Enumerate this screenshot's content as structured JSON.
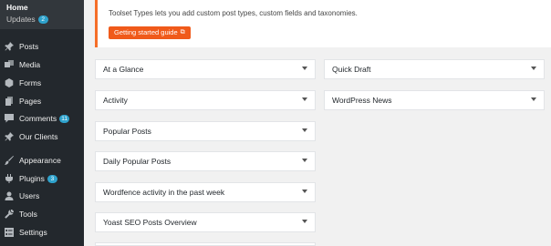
{
  "sidebar": {
    "home": "Home",
    "updates": {
      "label": "Updates",
      "count": "2"
    },
    "items": [
      {
        "label": "Posts",
        "icon": "pin-icon"
      },
      {
        "label": "Media",
        "icon": "media-icon"
      },
      {
        "label": "Forms",
        "icon": "forms-icon"
      },
      {
        "label": "Pages",
        "icon": "pages-icon"
      },
      {
        "label": "Comments",
        "icon": "comment-icon",
        "badge": "11"
      },
      {
        "label": "Our Clients",
        "icon": "pin-icon"
      },
      {
        "label": "Appearance",
        "icon": "brush-icon"
      },
      {
        "label": "Plugins",
        "icon": "plugin-icon",
        "badge": "3"
      },
      {
        "label": "Users",
        "icon": "user-icon"
      },
      {
        "label": "Tools",
        "icon": "wrench-icon"
      },
      {
        "label": "Settings",
        "icon": "settings-icon"
      }
    ]
  },
  "notice": {
    "message": "Toolset Types lets you add custom post types, custom fields and taxonomies.",
    "button": "Getting started guide"
  },
  "widgets": {
    "left": [
      "At a Glance",
      "Activity",
      "Popular Posts",
      "Daily Popular Posts",
      "Wordfence activity in the past week",
      "Yoast SEO Posts Overview"
    ],
    "right": [
      "Quick Draft",
      "WordPress News"
    ]
  },
  "colors": {
    "sidebar": "#23282d",
    "accent": "#f05a1a",
    "badge": "#2ea2cc"
  }
}
